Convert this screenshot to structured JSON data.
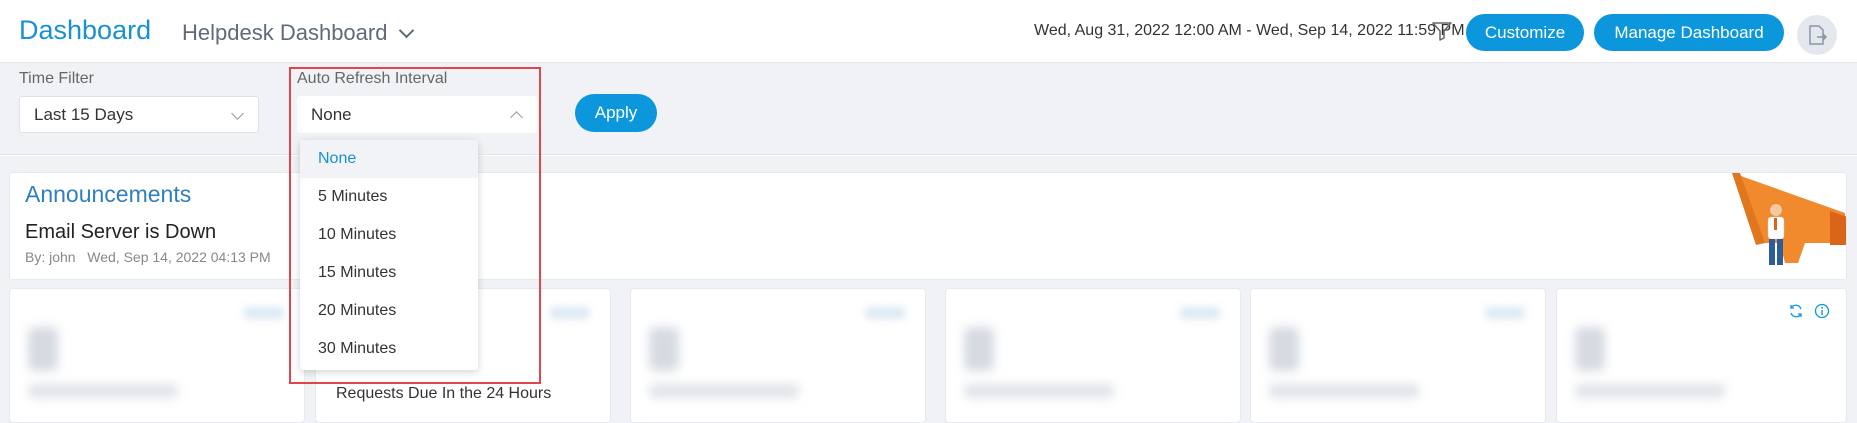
{
  "header": {
    "title": "Dashboard",
    "dashboard_name": "Helpdesk Dashboard",
    "date_range": "Wed, Aug 31, 2022 12:00 AM - Wed, Sep 14, 2022 11:59 PM",
    "customize_label": "Customize",
    "manage_label": "Manage Dashboard"
  },
  "filters": {
    "time_filter_label": "Time Filter",
    "time_filter_value": "Last 15 Days",
    "refresh_label": "Auto Refresh Interval",
    "refresh_value": "None",
    "apply_label": "Apply"
  },
  "refresh_options": [
    "None",
    "5 Minutes",
    "10 Minutes",
    "15 Minutes",
    "20 Minutes",
    "30 Minutes"
  ],
  "announcements": {
    "title": "Announcements",
    "item_title": "Email Server is Down",
    "item_meta": "By: john   Wed, Sep 14, 2022 04:13 PM"
  },
  "cards": {
    "visible_label": "Requests Due In the 24 Hours"
  },
  "colors": {
    "accent": "#0c97dd",
    "title": "#1a90d4",
    "highlight": "#e0464a"
  },
  "icons": [
    "funnel-icon",
    "user-logout-icon",
    "refresh-icon",
    "info-icon",
    "chevron-down-icon",
    "chevron-up-icon",
    "megaphone-illustration"
  ]
}
